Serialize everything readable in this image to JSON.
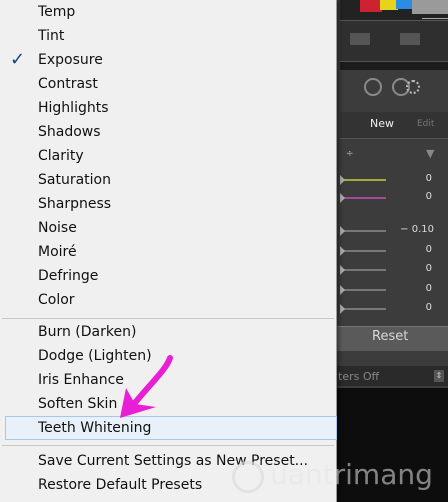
{
  "panel": {
    "new_label": "New",
    "edit_label": "Edit",
    "exposure_value": "− 0.10",
    "zero_value": "0",
    "reset_label": "Reset",
    "filters_label": "ters Off",
    "select_arrows": "÷",
    "dropdown_arrow": "▼",
    "filters_arrow": "⇕"
  },
  "menu": {
    "items": [
      {
        "label": "Temp",
        "checked": false
      },
      {
        "label": "Tint",
        "checked": false
      },
      {
        "label": "Exposure",
        "checked": true
      },
      {
        "label": "Contrast",
        "checked": false
      },
      {
        "label": "Highlights",
        "checked": false
      },
      {
        "label": "Shadows",
        "checked": false
      },
      {
        "label": "Clarity",
        "checked": false
      },
      {
        "label": "Saturation",
        "checked": false
      },
      {
        "label": "Sharpness",
        "checked": false
      },
      {
        "label": "Noise",
        "checked": false
      },
      {
        "label": "Moiré",
        "checked": false
      },
      {
        "label": "Defringe",
        "checked": false
      },
      {
        "label": "Color",
        "checked": false
      }
    ],
    "effects": [
      {
        "label": "Burn (Darken)"
      },
      {
        "label": "Dodge (Lighten)"
      },
      {
        "label": "Iris Enhance"
      },
      {
        "label": "Soften Skin"
      },
      {
        "label": "Teeth Whitening",
        "highlighted": true
      }
    ],
    "actions": [
      {
        "label": "Save Current Settings as New Preset..."
      },
      {
        "label": "Restore Default Presets"
      }
    ],
    "check_mark": "✓"
  },
  "annotation": {
    "arrow_color": "#e81fd4"
  },
  "watermark": {
    "text": "uantrimang"
  }
}
